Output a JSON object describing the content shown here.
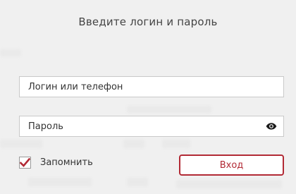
{
  "login_form": {
    "title": "Введите логин и пароль",
    "login": {
      "value": "",
      "placeholder": "Логин или телефон"
    },
    "password": {
      "value": "",
      "placeholder": "Пароль",
      "toggle_icon": "eye-icon"
    },
    "remember": {
      "label": "Запомнить",
      "checked": true,
      "check_icon": "checkmark-icon"
    },
    "submit_label": "Вход"
  },
  "colors": {
    "accent": "#b22a35",
    "background": "#f0f0f0",
    "field_border": "#c9c9c9",
    "text": "#333333"
  }
}
